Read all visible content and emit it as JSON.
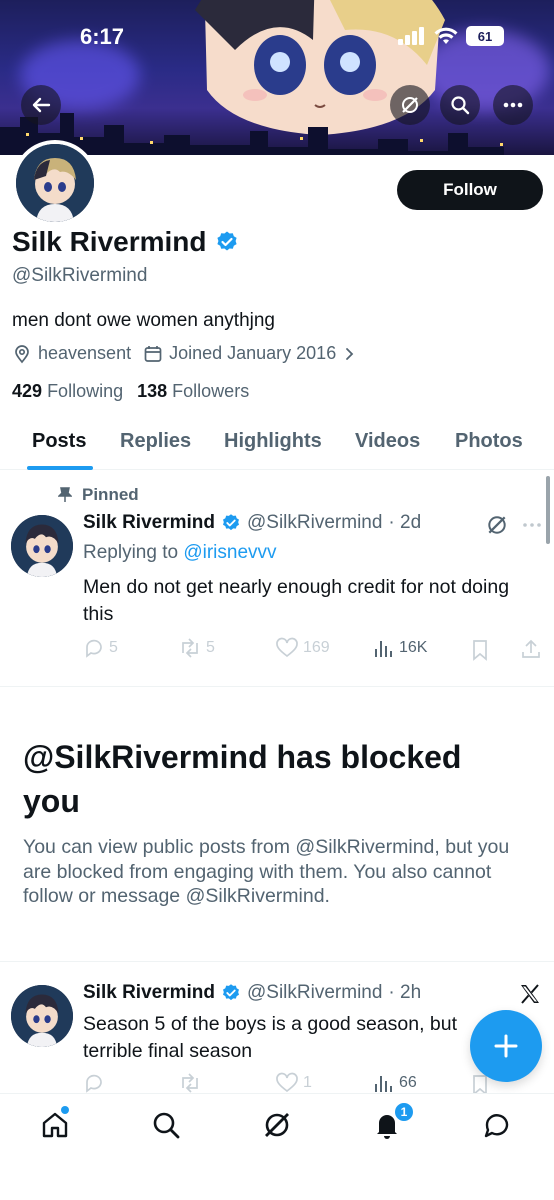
{
  "status_bar": {
    "time": "6:17",
    "battery": "61"
  },
  "profile": {
    "name": "Silk Rivermind",
    "handle": "@SilkRivermind",
    "bio": "men dont owe women anythjng",
    "location": "heavensent",
    "joined": "Joined January 2016",
    "following_count": "429",
    "following_label": "Following",
    "followers_count": "138",
    "followers_label": "Followers",
    "follow_button": "Follow"
  },
  "tabs": [
    "Posts",
    "Replies",
    "Highlights",
    "Videos",
    "Photos"
  ],
  "active_tab": "Posts",
  "pinned_post": {
    "pinned_label": "Pinned",
    "name": "Silk Rivermind",
    "handle": "@SilkRivermind",
    "time": "· 2d",
    "replying_prefix": "Replying to ",
    "replying_to": "@irisnevvv",
    "text": "Men do not get nearly enough credit for not doing this",
    "replies": "5",
    "reposts": "5",
    "likes": "169",
    "views": "16K"
  },
  "blocked_notice": {
    "title": "@SilkRivermind has blocked you",
    "body": "You can view public posts from @SilkRivermind, but you are blocked from engaging with them. You also cannot follow or message @SilkRivermind."
  },
  "second_post": {
    "name": "Silk Rivermind",
    "handle": "@SilkRivermind",
    "time": "· 2h",
    "text": "Season 5 of the boys is a good season, but terrible final season",
    "likes": "1",
    "views": "66"
  },
  "nav": {
    "notification_count": "1"
  },
  "colors": {
    "accent": "#1d9bf0",
    "text": "#0f1419",
    "muted": "#536471"
  }
}
